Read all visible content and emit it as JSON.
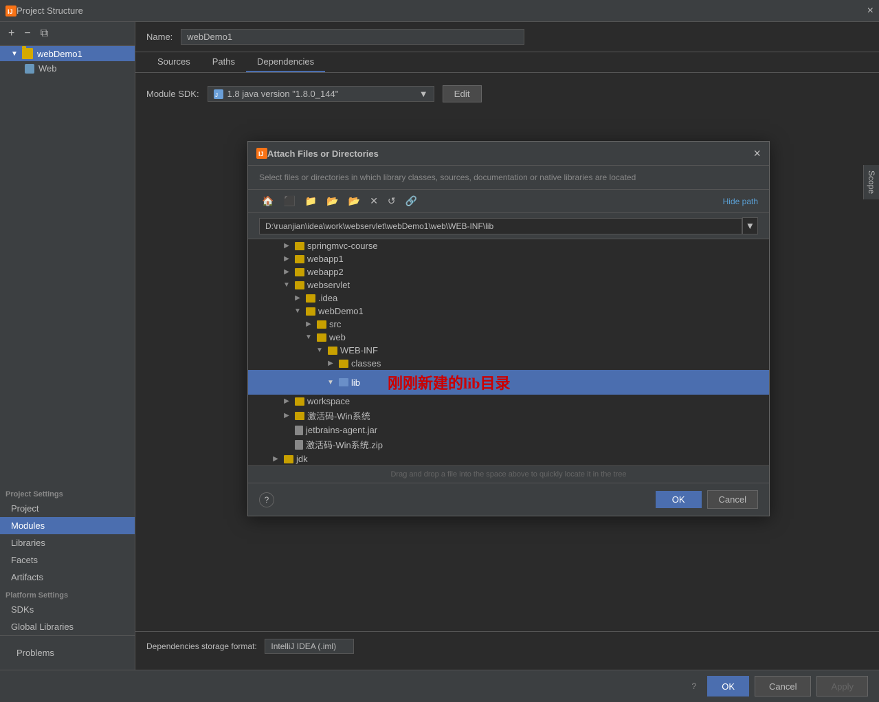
{
  "window": {
    "title": "Project Structure",
    "close_label": "×"
  },
  "sidebar": {
    "toolbar": {
      "add_label": "+",
      "remove_label": "−",
      "copy_label": "⧉"
    },
    "tree_items": [
      {
        "id": "webDemo1",
        "label": "webDemo1",
        "icon": "folder",
        "expanded": true,
        "indent": 0
      },
      {
        "id": "Web",
        "label": "Web",
        "icon": "web",
        "expanded": false,
        "indent": 1
      }
    ],
    "sections": {
      "project_settings": {
        "label": "Project Settings",
        "items": [
          {
            "id": "project",
            "label": "Project"
          },
          {
            "id": "modules",
            "label": "Modules",
            "active": true
          },
          {
            "id": "libraries",
            "label": "Libraries"
          },
          {
            "id": "facets",
            "label": "Facets"
          },
          {
            "id": "artifacts",
            "label": "Artifacts"
          }
        ]
      },
      "platform_settings": {
        "label": "Platform Settings",
        "items": [
          {
            "id": "sdks",
            "label": "SDKs"
          },
          {
            "id": "global_libraries",
            "label": "Global Libraries"
          }
        ]
      },
      "problems": {
        "label": "Problems"
      }
    }
  },
  "module": {
    "name_label": "Name:",
    "name_value": "webDemo1",
    "tabs": [
      {
        "id": "sources",
        "label": "Sources"
      },
      {
        "id": "paths",
        "label": "Paths"
      },
      {
        "id": "dependencies",
        "label": "Dependencies",
        "active": true
      }
    ],
    "sdk_label": "Module SDK:",
    "sdk_value": "1.8 java version \"1.8.0_144\"",
    "sdk_edit_label": "Edit",
    "scope_label": "Scope"
  },
  "bottom": {
    "storage_label": "Dependencies storage format:",
    "storage_value": "IntelliJ IDEA (.iml)",
    "storage_options": [
      "IntelliJ IDEA (.iml)"
    ]
  },
  "footer": {
    "ok_label": "OK",
    "cancel_label": "Cancel",
    "apply_label": "Apply"
  },
  "window_footer": {
    "help_label": "?"
  },
  "dialog": {
    "title": "Attach Files or Directories",
    "close_label": "×",
    "subtitle": "Select files or directories in which library classes, sources, documentation or native libraries are located",
    "toolbar": {
      "home_icon": "🏠",
      "up_icon": "⬆",
      "folder_icon": "📁",
      "new_folder_icon": "📂",
      "collapse_icon": "📂",
      "delete_icon": "✕",
      "refresh_icon": "↺",
      "link_icon": "🔗"
    },
    "hide_path_label": "Hide path",
    "path_value": "D:\\ruanjian\\idea\\work\\webservlet\\webDemo1\\web\\WEB-INF\\lib",
    "path_dropdown": "▼",
    "tree_items": [
      {
        "id": "springmvc-course",
        "label": "springmvc-course",
        "icon": "folder",
        "indent": 3,
        "expanded": false,
        "expand": "▶"
      },
      {
        "id": "webapp1",
        "label": "webapp1",
        "icon": "folder",
        "indent": 3,
        "expanded": false,
        "expand": "▶"
      },
      {
        "id": "webapp2",
        "label": "webapp2",
        "icon": "folder",
        "indent": 3,
        "expanded": false,
        "expand": "▶"
      },
      {
        "id": "webservlet",
        "label": "webservlet",
        "icon": "folder",
        "indent": 3,
        "expanded": true,
        "expand": "▼"
      },
      {
        "id": ".idea",
        "label": ".idea",
        "icon": "folder",
        "indent": 4,
        "expanded": false,
        "expand": "▶"
      },
      {
        "id": "webDemo1",
        "label": "webDemo1",
        "icon": "folder",
        "indent": 4,
        "expanded": true,
        "expand": "▼"
      },
      {
        "id": "src",
        "label": "src",
        "icon": "folder",
        "indent": 5,
        "expanded": false,
        "expand": "▶"
      },
      {
        "id": "web",
        "label": "web",
        "icon": "folder",
        "indent": 5,
        "expanded": true,
        "expand": "▼"
      },
      {
        "id": "WEB-INF",
        "label": "WEB-INF",
        "icon": "folder",
        "indent": 6,
        "expanded": true,
        "expand": "▼"
      },
      {
        "id": "classes",
        "label": "classes",
        "icon": "folder",
        "indent": 7,
        "expanded": false,
        "expand": "▶"
      },
      {
        "id": "lib",
        "label": "lib",
        "icon": "folder-blue",
        "indent": 7,
        "expanded": true,
        "expand": "▼",
        "selected": true
      },
      {
        "id": "workspace",
        "label": "workspace",
        "icon": "folder",
        "indent": 3,
        "expanded": false,
        "expand": "▶"
      },
      {
        "id": "activate-win",
        "label": "激活码-Win系统",
        "icon": "folder",
        "indent": 3,
        "expanded": false,
        "expand": "▶"
      },
      {
        "id": "jetbrains-agent",
        "label": "jetbrains-agent.jar",
        "icon": "file",
        "indent": 3,
        "expand": ""
      },
      {
        "id": "activate-zip",
        "label": "激活码-Win系统.zip",
        "icon": "file",
        "indent": 3,
        "expand": ""
      },
      {
        "id": "jdk",
        "label": "jdk",
        "icon": "folder",
        "indent": 2,
        "expanded": false,
        "expand": "▶"
      }
    ],
    "annotation": "刚刚新建的lib目录",
    "drag_hint": "Drag and drop a file into the space above to quickly locate it in the tree",
    "ok_label": "OK",
    "cancel_label": "Cancel",
    "help_label": "?"
  }
}
